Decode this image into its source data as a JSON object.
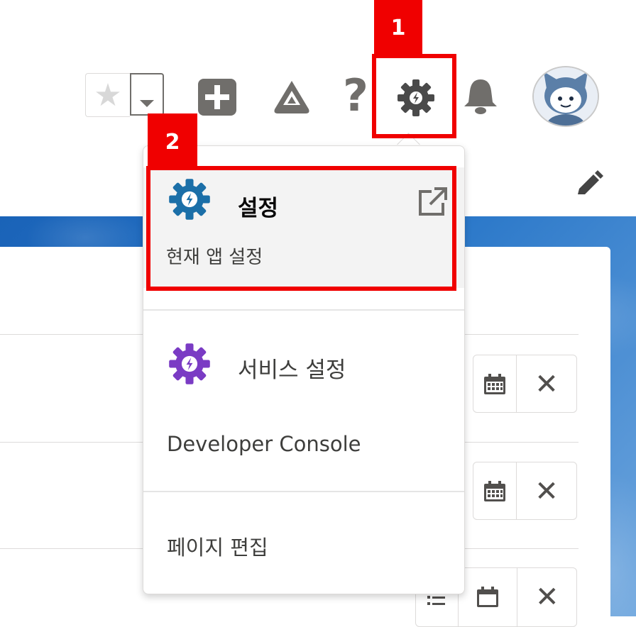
{
  "header": {
    "favorites_star": "★",
    "help_glyph": "?",
    "icons": [
      "star-icon",
      "chevron-down-icon",
      "add-icon",
      "trailhead-icon",
      "help-icon",
      "gear-icon",
      "bell-icon",
      "avatar"
    ]
  },
  "annotations": {
    "marker_1": "1",
    "marker_2": "2",
    "color": "#f00000"
  },
  "setup_menu": {
    "setup": {
      "title": "설정",
      "subtitle": "현재 앱 설정",
      "icon": "setup-gear-icon",
      "icon_color": "#1b6fa8",
      "external_icon": "external-link-icon"
    },
    "service_setup": {
      "title": "서비스 설정",
      "icon": "service-setup-gear-icon",
      "icon_color": "#7a3bc4"
    },
    "developer_console": "Developer Console",
    "edit_page": "페이지 편집"
  },
  "background_rows": {
    "close_glyph": "✕",
    "icons": [
      "calendar-icon",
      "close-icon",
      "list-icon"
    ]
  },
  "colors": {
    "brand_blue": "#1a63b8",
    "border": "#dddbda",
    "icon_gray": "#706e6b"
  }
}
